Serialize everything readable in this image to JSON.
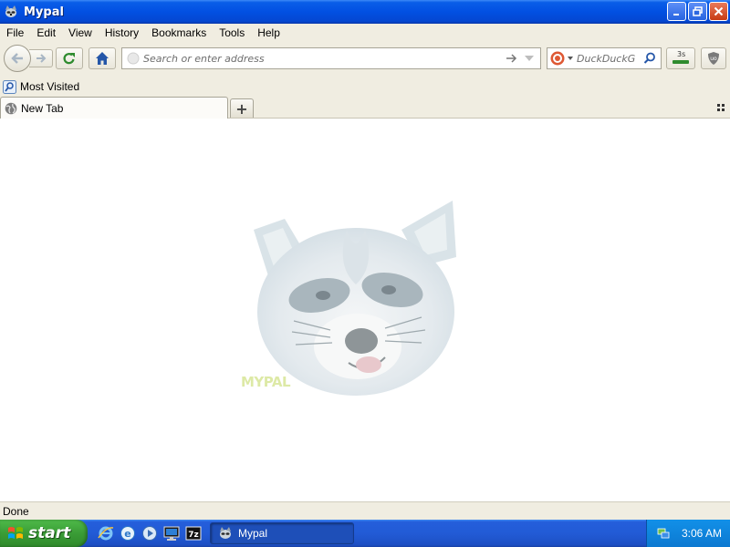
{
  "window": {
    "title": "Mypal"
  },
  "menu": [
    "File",
    "Edit",
    "View",
    "History",
    "Bookmarks",
    "Tools",
    "Help"
  ],
  "navbar": {
    "url_placeholder": "Search or enter address",
    "search_placeholder": "DuckDuckGo",
    "addon_badge": "3s"
  },
  "bookmarks": {
    "most_visited": "Most Visited"
  },
  "tabs": [
    {
      "label": "New Tab"
    }
  ],
  "newtab_label": "+",
  "content": {
    "logo_text": "MYPAL"
  },
  "status": {
    "text": "Done"
  },
  "taskbar": {
    "start_label": "start",
    "task_label": "Mypal",
    "clock": "3:06 AM"
  }
}
